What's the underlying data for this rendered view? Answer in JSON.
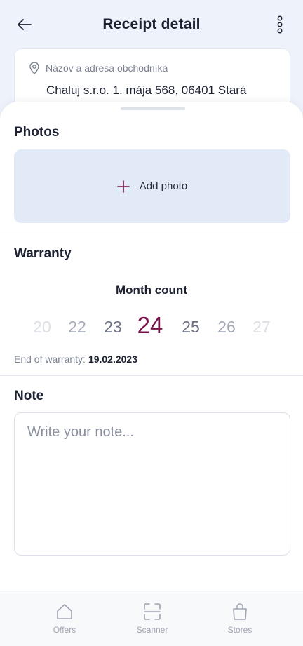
{
  "header": {
    "title": "Receipt detail",
    "back_icon": "arrow-left-icon",
    "more_icon": "more-vertical-icon"
  },
  "merchant": {
    "label": "Názov a adresa obchodníka",
    "value": "Chaluj s.r.o. 1. mája 568, 06401 Stará",
    "icon": "location-pin-icon"
  },
  "photos": {
    "title": "Photos",
    "add_label": "Add photo",
    "add_icon": "plus-icon"
  },
  "warranty": {
    "title": "Warranty",
    "month_count_label": "Month count",
    "options": [
      "20",
      "22",
      "23",
      "24",
      "25",
      "26",
      "27"
    ],
    "selected": "24",
    "end_label": "End of warranty:",
    "end_value": "19.02.2023"
  },
  "note": {
    "title": "Note",
    "placeholder": "Write your note..."
  },
  "nav": {
    "items": [
      {
        "label": "Offers",
        "icon": "home-icon"
      },
      {
        "label": "Scanner",
        "icon": "scan-icon"
      },
      {
        "label": "Stores",
        "icon": "shopping-bag-icon"
      }
    ]
  },
  "colors": {
    "accent": "#7a1048",
    "background": "#eef3fb",
    "photo_area": "#e3eaf7"
  }
}
